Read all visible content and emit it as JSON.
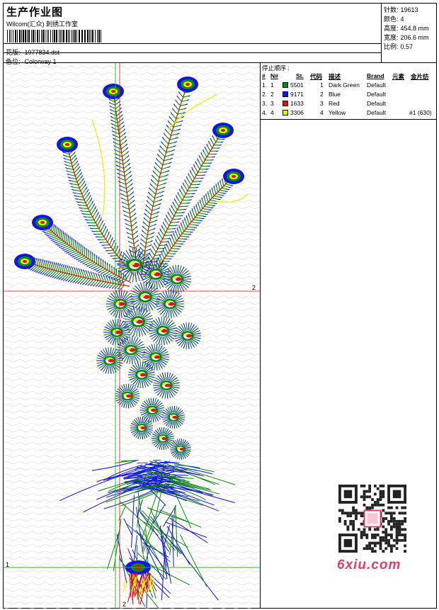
{
  "header": {
    "title": "生产作业图",
    "company": "Wilcom(汇众) 刺绣工作室",
    "design_label": "花版:",
    "design_value": "1977834.dst",
    "colorway_label": "色位:",
    "colorway_value": "Colorway 1"
  },
  "stats": {
    "stitches_label": "针数:",
    "stitches_value": "19613",
    "colors_label": "颜色:",
    "colors_value": "4",
    "height_label": "高度:",
    "height_value": "454.8 mm",
    "width_label": "宽度:",
    "width_value": "206.6 mm",
    "scale_label": "比例:",
    "scale_value": "0.57"
  },
  "stop_sequence": {
    "title": "停止顺序 :",
    "columns": [
      "#",
      "N#",
      "St.",
      "代码",
      "描述",
      "Brand",
      "元素",
      "金片纺"
    ],
    "rows": [
      {
        "idx": "1.",
        "n": "1",
        "st": "5501",
        "code": "1",
        "desc": "Dark Green",
        "brand": "Default",
        "extra": "",
        "color": "#0a8a0a"
      },
      {
        "idx": "2.",
        "n": "2",
        "st": "9171",
        "code": "2",
        "desc": "Blue",
        "brand": "Default",
        "extra": "",
        "color": "#1414e6"
      },
      {
        "idx": "3.",
        "n": "3",
        "st": "1633",
        "code": "3",
        "desc": "Red",
        "brand": "Default",
        "extra": "",
        "color": "#e01010"
      },
      {
        "idx": "4.",
        "n": "4",
        "st": "3306",
        "code": "4",
        "desc": "Yellow",
        "brand": "Default",
        "extra": "#1 (630)",
        "color": "#f0f000"
      }
    ]
  },
  "canvas": {
    "marker_1": "1",
    "marker_2_right": "2",
    "marker_2_bottom": "2",
    "guide_h_color": "#e01010",
    "guide_v_color": "#10c010"
  },
  "watermark": {
    "brand": "6xiu.com",
    "brand_color": "#e23b6e"
  }
}
